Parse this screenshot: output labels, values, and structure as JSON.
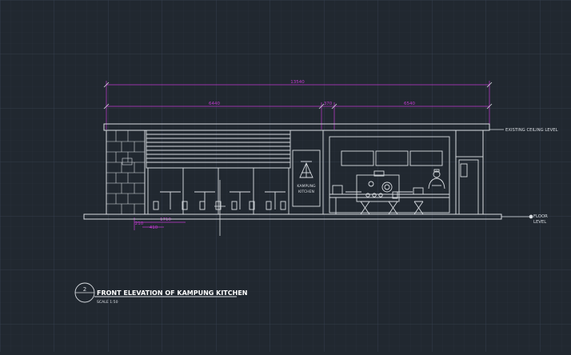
{
  "drawing": {
    "sheet_number": "2",
    "title": "FRONT ELEVATION OF KAMPUNG KITCHEN",
    "scale": "SCALE 1:50",
    "sign_line1": "KAMPUNG",
    "sign_line2": "KITCHEN",
    "label_ceiling": "EXISTING CEILING LEVEL",
    "label_floor_1": "FLOOR",
    "label_floor_2": "LEVEL"
  },
  "dimensions": {
    "overall": "13540",
    "left_span": "6440",
    "mid_span": "370",
    "right_span": "6540",
    "bottom_1": "210",
    "bottom_2": "1710",
    "bottom_3": "410"
  },
  "colors": {
    "background": "#212830",
    "grid_minor": "#2a323c",
    "grid_major": "#353e49",
    "linework": "#d9dde2",
    "dimension": "#c23ad0"
  }
}
